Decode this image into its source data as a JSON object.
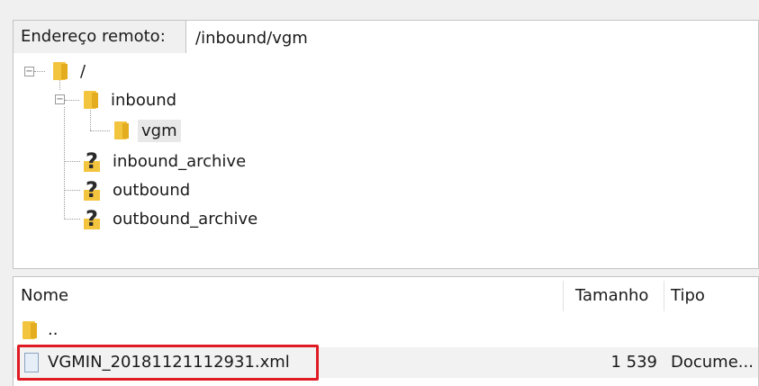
{
  "remote_path": {
    "label": "Endereço remoto:",
    "value": "/inbound/vgm"
  },
  "tree": {
    "root": {
      "label": "/",
      "icon": "folder-icon",
      "expanded": true
    },
    "inbound": {
      "label": "inbound",
      "icon": "folder-icon",
      "expanded": true
    },
    "vgm": {
      "label": "vgm",
      "icon": "folder-icon",
      "selected": true
    },
    "inbound_archive": {
      "label": "inbound_archive",
      "icon": "unknown-folder-icon"
    },
    "outbound": {
      "label": "outbound",
      "icon": "unknown-folder-icon"
    },
    "outbound_archive": {
      "label": "outbound_archive",
      "icon": "unknown-folder-icon"
    }
  },
  "file_list": {
    "columns": {
      "name": "Nome",
      "size": "Tamanho",
      "type": "Tipo"
    },
    "parent": {
      "name": "..",
      "icon": "folder-icon"
    },
    "files": [
      {
        "name": "VGMIN_20181121112931.xml",
        "size": "1 539",
        "type": "Docume...",
        "icon": "document-icon",
        "highlighted": true
      }
    ]
  },
  "colors": {
    "highlight": "#e01b24",
    "folder": "#f3c53f"
  }
}
